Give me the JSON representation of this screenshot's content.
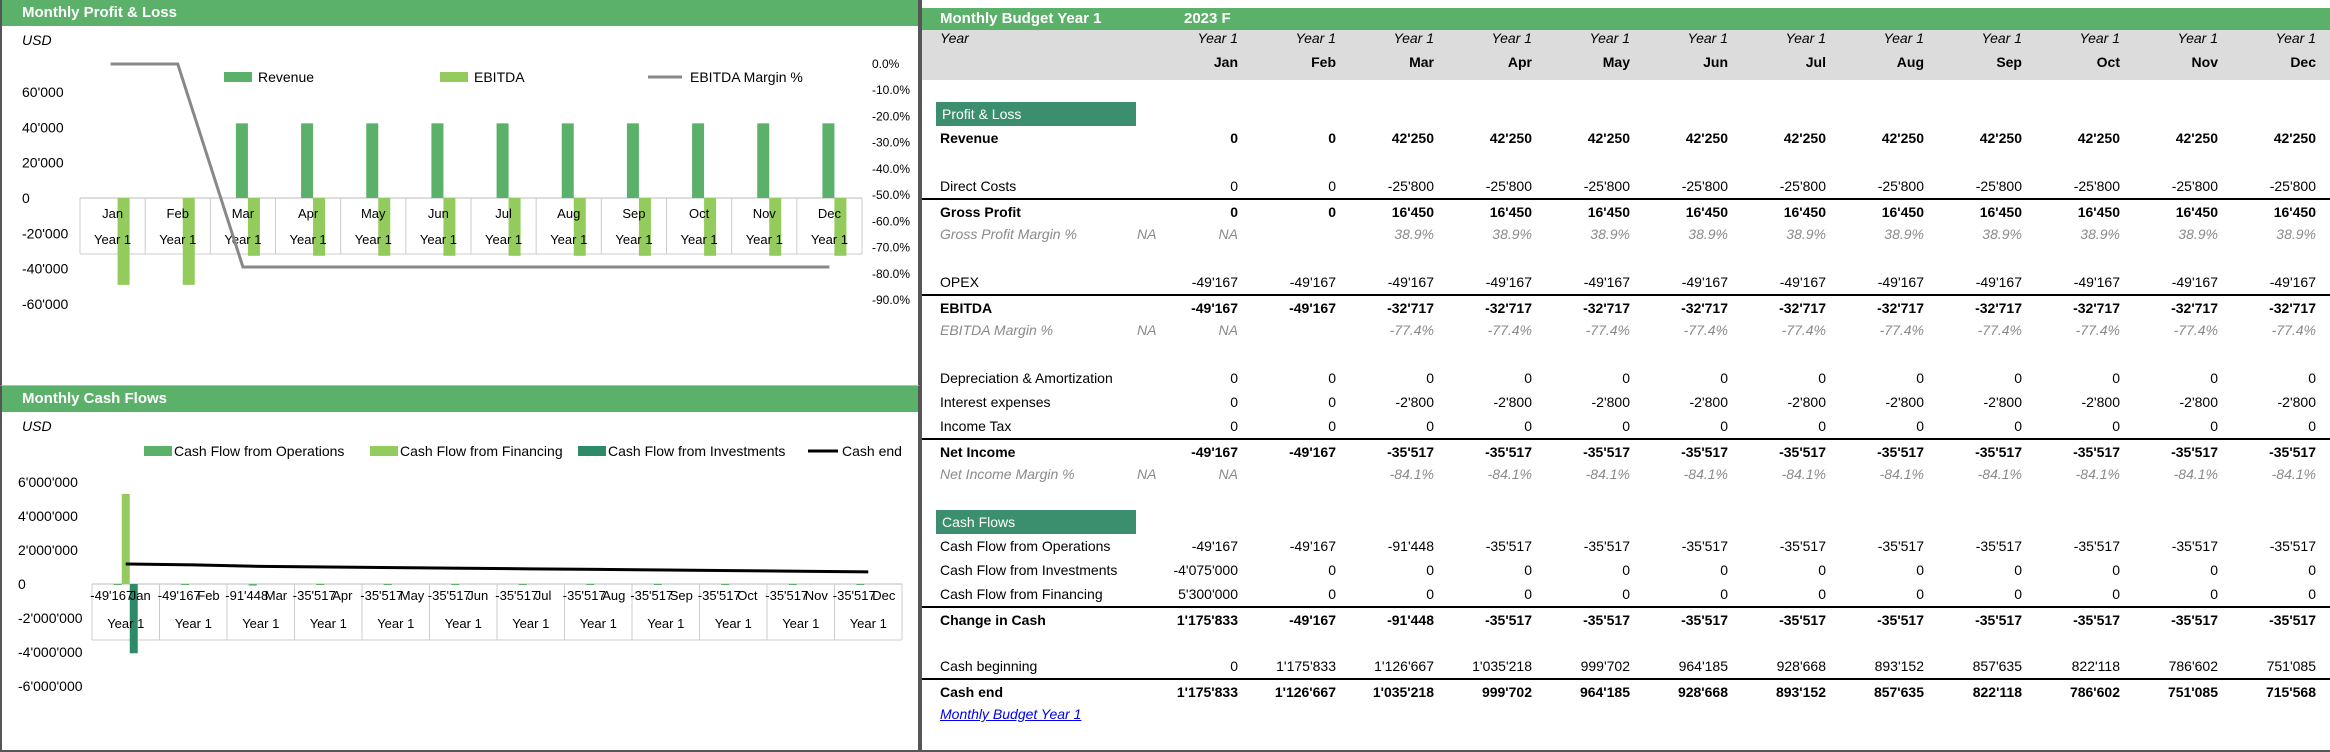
{
  "pl_panel": {
    "title": "Monthly Profit & Loss",
    "unit": "USD",
    "legend": [
      "Revenue",
      "EBITDA",
      "EBITDA Margin %"
    ],
    "colors": {
      "revenue": "#5bb06a",
      "ebitda": "#93cc5c",
      "margin": "#888888"
    }
  },
  "cf_panel": {
    "title": "Monthly Cash Flows",
    "unit": "USD",
    "legend": [
      "Cash Flow from Operations",
      "Cash Flow from Financing",
      "Cash Flow from Investments",
      "Cash end"
    ],
    "colors": {
      "ops": "#5bb06a",
      "fin": "#93cc5c",
      "inv": "#2e8b6a",
      "cash": "#000000"
    }
  },
  "chart_data": [
    {
      "type": "bar",
      "title": "",
      "categories": [
        "Jan",
        "Feb",
        "Mar",
        "Apr",
        "May",
        "Jun",
        "Jul",
        "Aug",
        "Sep",
        "Oct",
        "Nov",
        "Dec"
      ],
      "category_sublabel": "Year 1",
      "series": [
        {
          "name": "Revenue",
          "values": [
            0,
            0,
            42250,
            42250,
            42250,
            42250,
            42250,
            42250,
            42250,
            42250,
            42250,
            42250
          ]
        },
        {
          "name": "EBITDA",
          "values": [
            -49167,
            -49167,
            -32717,
            -32717,
            -32717,
            -32717,
            -32717,
            -32717,
            -32717,
            -32717,
            -32717,
            -32717
          ]
        },
        {
          "name": "EBITDA Margin %",
          "axis": "right",
          "type": "line",
          "values": [
            0,
            0,
            -77.4,
            -77.4,
            -77.4,
            -77.4,
            -77.4,
            -77.4,
            -77.4,
            -77.4,
            -77.4,
            -77.4
          ]
        }
      ],
      "ylim": [
        -60000,
        60000
      ],
      "yticks": [
        "60'000",
        "40'000",
        "20'000",
        "0",
        "-20'000",
        "-40'000",
        "-60'000"
      ],
      "y2lim": [
        -90,
        0
      ],
      "y2ticks": [
        "0.0%",
        "-10.0%",
        "-20.0%",
        "-30.0%",
        "-40.0%",
        "-50.0%",
        "-60.0%",
        "-70.0%",
        "-80.0%",
        "-90.0%"
      ],
      "legend_position": "top"
    },
    {
      "type": "bar",
      "title": "",
      "categories": [
        "-49'167",
        "-49'167",
        "-91'448",
        "-35'517",
        "-35'517",
        "-35'517",
        "-35'517",
        "-35'517",
        "-35'517",
        "-35'517",
        "-35'517",
        "-35'517"
      ],
      "categories_overlap": [
        "Jan",
        "Feb",
        "Mar",
        "Apr",
        "May",
        "Jun",
        "Jul",
        "Aug",
        "Sep",
        "Oct",
        "Nov",
        "Dec"
      ],
      "category_sublabel": "Year 1",
      "series": [
        {
          "name": "Cash Flow from Operations",
          "values": [
            -49167,
            -49167,
            -91448,
            -35517,
            -35517,
            -35517,
            -35517,
            -35517,
            -35517,
            -35517,
            -35517,
            -35517
          ]
        },
        {
          "name": "Cash Flow from Financing",
          "values": [
            5300000,
            0,
            0,
            0,
            0,
            0,
            0,
            0,
            0,
            0,
            0,
            0
          ]
        },
        {
          "name": "Cash Flow from Investments",
          "values": [
            -4075000,
            0,
            0,
            0,
            0,
            0,
            0,
            0,
            0,
            0,
            0,
            0
          ]
        },
        {
          "name": "Cash end",
          "type": "line",
          "values": [
            1175833,
            1126667,
            1035218,
            999702,
            964185,
            928668,
            893152,
            857635,
            822118,
            786602,
            751085,
            715568
          ]
        }
      ],
      "ylim": [
        -6000000,
        6000000
      ],
      "yticks": [
        "6'000'000",
        "4'000'000",
        "2'000'000",
        "0",
        "-2'000'000",
        "-4'000'000",
        "-6'000'000"
      ],
      "legend_position": "top"
    }
  ],
  "budget": {
    "title": "Monthly Budget Year 1",
    "year_tag": "2023 F",
    "year_label": "Year",
    "year_row": [
      "Year 1",
      "Year 1",
      "Year 1",
      "Year 1",
      "Year 1",
      "Year 1",
      "Year 1",
      "Year 1",
      "Year 1",
      "Year 1",
      "Year 1",
      "Year 1"
    ],
    "months": [
      "Jan",
      "Feb",
      "Mar",
      "Apr",
      "May",
      "Jun",
      "Jul",
      "Aug",
      "Sep",
      "Oct",
      "Nov",
      "Dec"
    ],
    "section_pl": "Profit & Loss",
    "section_cf": "Cash Flows",
    "rows": [
      {
        "label": "Revenue",
        "style": "bold",
        "values": [
          "0",
          "0",
          "42'250",
          "42'250",
          "42'250",
          "42'250",
          "42'250",
          "42'250",
          "42'250",
          "42'250",
          "42'250",
          "42'250"
        ]
      },
      {
        "label": "Direct Costs",
        "style": "normal",
        "values": [
          "0",
          "0",
          "-25'800",
          "-25'800",
          "-25'800",
          "-25'800",
          "-25'800",
          "-25'800",
          "-25'800",
          "-25'800",
          "-25'800",
          "-25'800"
        ]
      },
      {
        "label": "Gross Profit",
        "style": "total",
        "values": [
          "0",
          "0",
          "16'450",
          "16'450",
          "16'450",
          "16'450",
          "16'450",
          "16'450",
          "16'450",
          "16'450",
          "16'450",
          "16'450"
        ]
      },
      {
        "label": "Gross Profit Margin %",
        "style": "pct",
        "na": "NA",
        "values": [
          "NA",
          "",
          "38.9%",
          "38.9%",
          "38.9%",
          "38.9%",
          "38.9%",
          "38.9%",
          "38.9%",
          "38.9%",
          "38.9%",
          "38.9%"
        ]
      },
      {
        "label": "OPEX",
        "style": "normal",
        "values": [
          "-49'167",
          "-49'167",
          "-49'167",
          "-49'167",
          "-49'167",
          "-49'167",
          "-49'167",
          "-49'167",
          "-49'167",
          "-49'167",
          "-49'167",
          "-49'167"
        ]
      },
      {
        "label": "EBITDA",
        "style": "total",
        "values": [
          "-49'167",
          "-49'167",
          "-32'717",
          "-32'717",
          "-32'717",
          "-32'717",
          "-32'717",
          "-32'717",
          "-32'717",
          "-32'717",
          "-32'717",
          "-32'717"
        ]
      },
      {
        "label": "EBITDA Margin %",
        "style": "pct",
        "na": "NA",
        "values": [
          "NA",
          "",
          "-77.4%",
          "-77.4%",
          "-77.4%",
          "-77.4%",
          "-77.4%",
          "-77.4%",
          "-77.4%",
          "-77.4%",
          "-77.4%",
          "-77.4%"
        ]
      },
      {
        "label": "Depreciation & Amortization",
        "style": "normal",
        "values": [
          "0",
          "0",
          "0",
          "0",
          "0",
          "0",
          "0",
          "0",
          "0",
          "0",
          "0",
          "0"
        ]
      },
      {
        "label": "Interest expenses",
        "style": "normal",
        "values": [
          "0",
          "0",
          "-2'800",
          "-2'800",
          "-2'800",
          "-2'800",
          "-2'800",
          "-2'800",
          "-2'800",
          "-2'800",
          "-2'800",
          "-2'800"
        ]
      },
      {
        "label": "Income Tax",
        "style": "normal",
        "values": [
          "0",
          "0",
          "0",
          "0",
          "0",
          "0",
          "0",
          "0",
          "0",
          "0",
          "0",
          "0"
        ]
      },
      {
        "label": "Net Income",
        "style": "total",
        "values": [
          "-49'167",
          "-49'167",
          "-35'517",
          "-35'517",
          "-35'517",
          "-35'517",
          "-35'517",
          "-35'517",
          "-35'517",
          "-35'517",
          "-35'517",
          "-35'517"
        ]
      },
      {
        "label": "Net Income Margin %",
        "style": "pct",
        "na": "NA",
        "values": [
          "NA",
          "",
          "-84.1%",
          "-84.1%",
          "-84.1%",
          "-84.1%",
          "-84.1%",
          "-84.1%",
          "-84.1%",
          "-84.1%",
          "-84.1%",
          "-84.1%"
        ]
      },
      {
        "label": "Cash Flow from Operations",
        "style": "normal",
        "values": [
          "-49'167",
          "-49'167",
          "-91'448",
          "-35'517",
          "-35'517",
          "-35'517",
          "-35'517",
          "-35'517",
          "-35'517",
          "-35'517",
          "-35'517",
          "-35'517"
        ]
      },
      {
        "label": "Cash Flow from Investments",
        "style": "normal",
        "values": [
          "-4'075'000",
          "0",
          "0",
          "0",
          "0",
          "0",
          "0",
          "0",
          "0",
          "0",
          "0",
          "0"
        ]
      },
      {
        "label": "Cash Flow from Financing",
        "style": "normal",
        "values": [
          "5'300'000",
          "0",
          "0",
          "0",
          "0",
          "0",
          "0",
          "0",
          "0",
          "0",
          "0",
          "0"
        ]
      },
      {
        "label": "Change in Cash",
        "style": "total",
        "values": [
          "1'175'833",
          "-49'167",
          "-91'448",
          "-35'517",
          "-35'517",
          "-35'517",
          "-35'517",
          "-35'517",
          "-35'517",
          "-35'517",
          "-35'517",
          "-35'517"
        ]
      },
      {
        "label": "Cash beginning",
        "style": "normal",
        "values": [
          "0",
          "1'175'833",
          "1'126'667",
          "1'035'218",
          "999'702",
          "964'185",
          "928'668",
          "893'152",
          "857'635",
          "822'118",
          "786'602",
          "751'085"
        ]
      },
      {
        "label": "Cash end",
        "style": "total",
        "values": [
          "1'175'833",
          "1'126'667",
          "1'035'218",
          "999'702",
          "964'185",
          "928'668",
          "893'152",
          "857'635",
          "822'118",
          "786'602",
          "751'085",
          "715'568"
        ]
      }
    ],
    "link_text": "Monthly Budget Year 1"
  }
}
